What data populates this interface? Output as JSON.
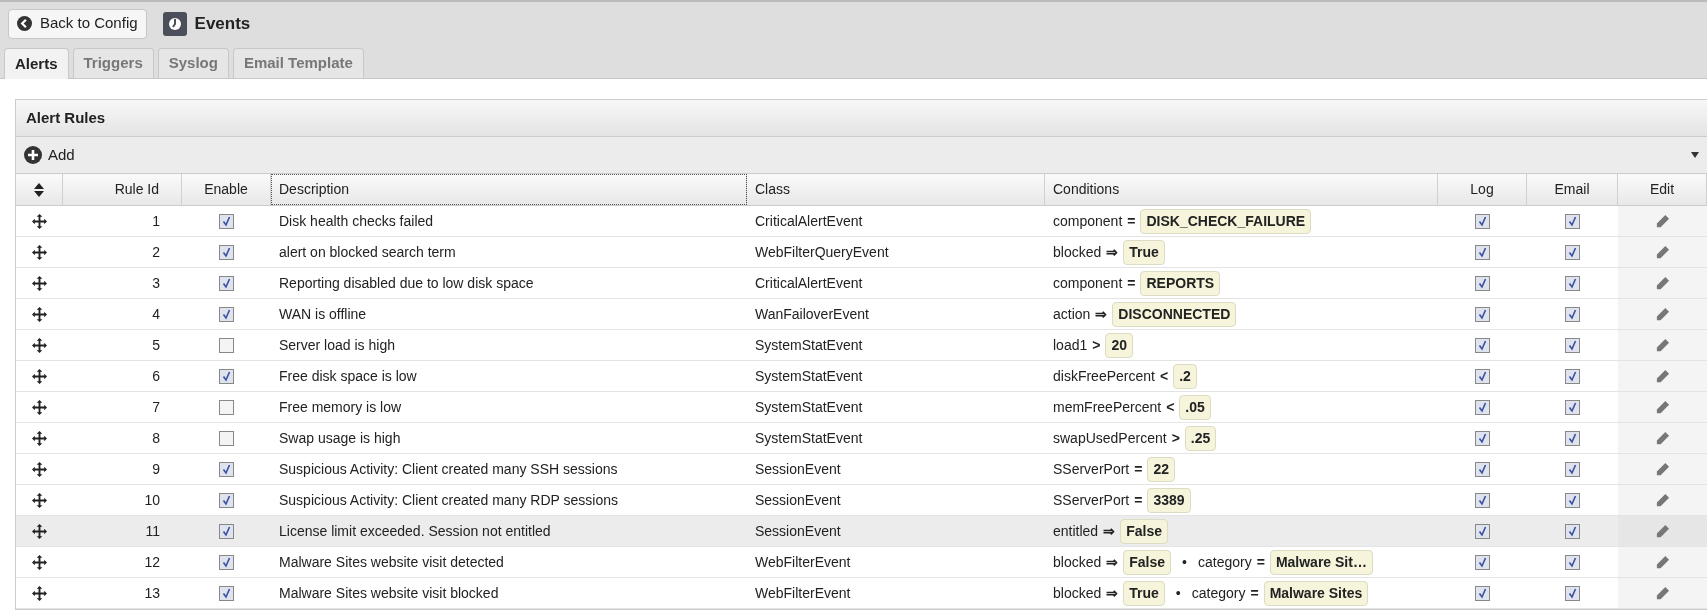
{
  "toolbar": {
    "back_button": "Back to Config",
    "title": "Events"
  },
  "tabs": [
    {
      "label": "Alerts",
      "selected": true
    },
    {
      "label": "Triggers",
      "selected": false
    },
    {
      "label": "Syslog",
      "selected": false
    },
    {
      "label": "Email Template",
      "selected": false
    }
  ],
  "panel": {
    "title": "Alert Rules",
    "add_button": "Add"
  },
  "table": {
    "columns": [
      "Rule Id",
      "Enable",
      "Description",
      "Class",
      "Conditions",
      "Log",
      "Email",
      "Edit"
    ],
    "rows": [
      {
        "rule_id": "1",
        "enabled": true,
        "description": "Disk health checks failed",
        "class": "CriticalAlertEvent",
        "conditions": [
          {
            "field": "component",
            "op": "=",
            "value": "DISK_CHECK_FAILURE"
          }
        ],
        "log": true,
        "email": true,
        "highlighted": false
      },
      {
        "rule_id": "2",
        "enabled": true,
        "description": "alert on blocked search term",
        "class": "WebFilterQueryEvent",
        "conditions": [
          {
            "field": "blocked",
            "op": "⇒",
            "value": "True"
          }
        ],
        "log": true,
        "email": true,
        "highlighted": false
      },
      {
        "rule_id": "3",
        "enabled": true,
        "description": "Reporting disabled due to low disk space",
        "class": "CriticalAlertEvent",
        "conditions": [
          {
            "field": "component",
            "op": "=",
            "value": "REPORTS"
          }
        ],
        "log": true,
        "email": true,
        "highlighted": false
      },
      {
        "rule_id": "4",
        "enabled": true,
        "description": "WAN is offline",
        "class": "WanFailoverEvent",
        "conditions": [
          {
            "field": "action",
            "op": "⇒",
            "value": "DISCONNECTED"
          }
        ],
        "log": true,
        "email": true,
        "highlighted": false
      },
      {
        "rule_id": "5",
        "enabled": false,
        "description": "Server load is high",
        "class": "SystemStatEvent",
        "conditions": [
          {
            "field": "load1",
            "op": ">",
            "value": "20"
          }
        ],
        "log": true,
        "email": true,
        "highlighted": false
      },
      {
        "rule_id": "6",
        "enabled": true,
        "description": "Free disk space is low",
        "class": "SystemStatEvent",
        "conditions": [
          {
            "field": "diskFreePercent",
            "op": "<",
            "value": ".2"
          }
        ],
        "log": true,
        "email": true,
        "highlighted": false
      },
      {
        "rule_id": "7",
        "enabled": false,
        "description": "Free memory is low",
        "class": "SystemStatEvent",
        "conditions": [
          {
            "field": "memFreePercent",
            "op": "<",
            "value": ".05"
          }
        ],
        "log": true,
        "email": true,
        "highlighted": false
      },
      {
        "rule_id": "8",
        "enabled": false,
        "description": "Swap usage is high",
        "class": "SystemStatEvent",
        "conditions": [
          {
            "field": "swapUsedPercent",
            "op": ">",
            "value": ".25"
          }
        ],
        "log": true,
        "email": true,
        "highlighted": false
      },
      {
        "rule_id": "9",
        "enabled": true,
        "description": "Suspicious Activity: Client created many SSH sessions",
        "class": "SessionEvent",
        "conditions": [
          {
            "field": "SServerPort",
            "op": "=",
            "value": "22"
          }
        ],
        "log": true,
        "email": true,
        "highlighted": false
      },
      {
        "rule_id": "10",
        "enabled": true,
        "description": "Suspicious Activity: Client created many RDP sessions",
        "class": "SessionEvent",
        "conditions": [
          {
            "field": "SServerPort",
            "op": "=",
            "value": "3389"
          }
        ],
        "log": true,
        "email": true,
        "highlighted": false
      },
      {
        "rule_id": "11",
        "enabled": true,
        "description": "License limit exceeded. Session not entitled",
        "class": "SessionEvent",
        "conditions": [
          {
            "field": "entitled",
            "op": "⇒",
            "value": "False"
          }
        ],
        "log": true,
        "email": true,
        "highlighted": true
      },
      {
        "rule_id": "12",
        "enabled": true,
        "description": "Malware Sites website visit detected",
        "class": "WebFilterEvent",
        "conditions": [
          {
            "field": "blocked",
            "op": "⇒",
            "value": "False"
          },
          {
            "separator": "•",
            "field": "category",
            "op": "=",
            "value": "Malware Sit…"
          }
        ],
        "log": true,
        "email": true,
        "highlighted": false
      },
      {
        "rule_id": "13",
        "enabled": true,
        "description": "Malware Sites website visit blocked",
        "class": "WebFilterEvent",
        "conditions": [
          {
            "field": "blocked",
            "op": "⇒",
            "value": "True"
          },
          {
            "separator": "•",
            "field": "category",
            "op": "=",
            "value": "Malware Sites"
          }
        ],
        "log": true,
        "email": true,
        "highlighted": false
      }
    ]
  }
}
